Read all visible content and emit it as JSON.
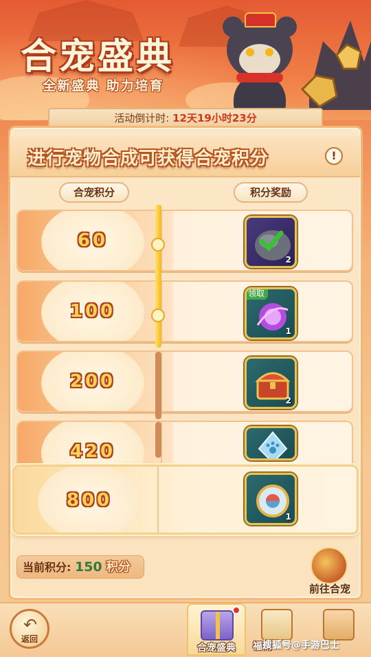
{
  "header": {
    "title": "合宠盛典",
    "subtitle": "全新盛典 助力培育"
  },
  "countdown": {
    "label": "活动倒计时:",
    "value": "12天19小时23分"
  },
  "banner": {
    "text": "进行宠物合成可获得合宠积分",
    "info_icon": "!"
  },
  "columns": {
    "left": "合宠积分",
    "right": "积分奖励"
  },
  "rows": [
    {
      "score": "60",
      "reward_icon": "stone-claimed-icon",
      "count": "2",
      "claimed": true
    },
    {
      "score": "100",
      "reward_icon": "purple-orb-icon",
      "count": "1",
      "tag": "领取"
    },
    {
      "score": "200",
      "reward_icon": "treasure-chest-icon",
      "count": "2"
    },
    {
      "score": "420",
      "reward_icon": "paw-crystal-icon",
      "count": ""
    },
    {
      "score": "800",
      "reward_icon": "compass-orb-icon",
      "count": "1"
    }
  ],
  "progress": {
    "current_score": 150,
    "reached_index": 1
  },
  "footer": {
    "current_label": "当前积分:",
    "current_value": "150",
    "current_unit": "积分",
    "goto_label": "前往合宠",
    "back_label": "返回"
  },
  "tabs": [
    {
      "label": "合宠盛典",
      "active": true
    },
    {
      "label": "福利"
    }
  ],
  "watermark": "搜狐号@手游巴士",
  "colors": {
    "accent": "#d4371c",
    "gold": "#f6d25a",
    "panel": "#fbe6c6"
  }
}
